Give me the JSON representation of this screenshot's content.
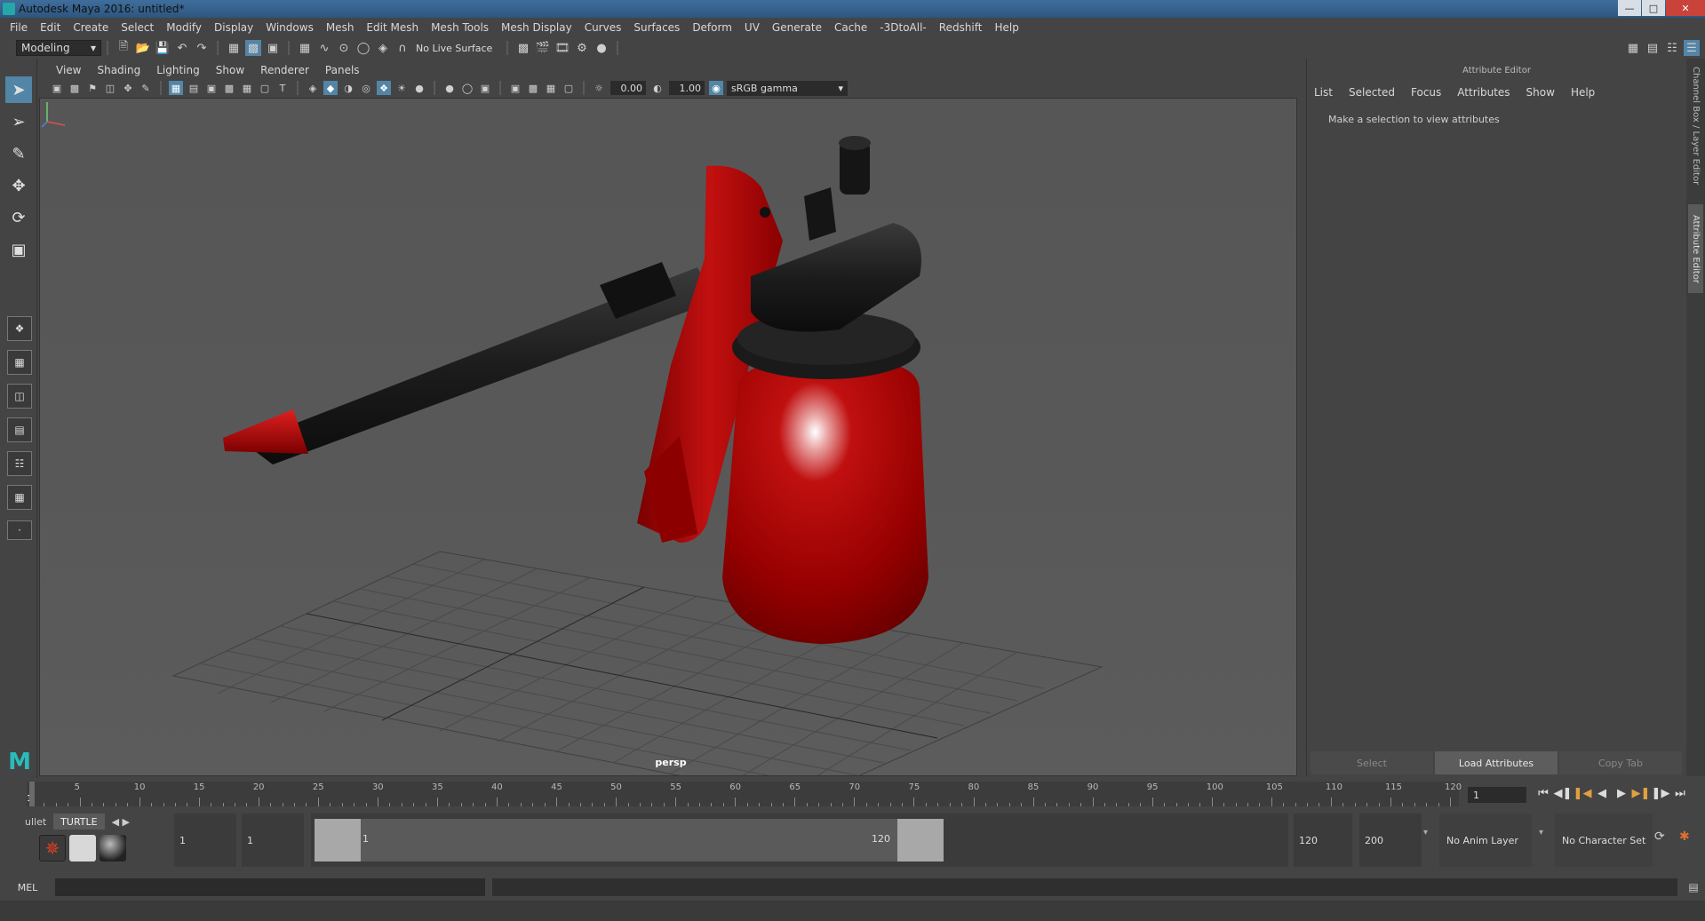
{
  "window": {
    "title": "Autodesk Maya 2016: untitled*"
  },
  "menubar": [
    "File",
    "Edit",
    "Create",
    "Select",
    "Modify",
    "Display",
    "Windows",
    "Mesh",
    "Edit Mesh",
    "Mesh Tools",
    "Mesh Display",
    "Curves",
    "Surfaces",
    "Deform",
    "UV",
    "Generate",
    "Cache",
    "-3DtoAll-",
    "Redshift",
    "Help"
  ],
  "statusline": {
    "mode": "Modeling",
    "live_surface": "No Live Surface"
  },
  "panel": {
    "menu": [
      "View",
      "Shading",
      "Lighting",
      "Show",
      "Renderer",
      "Panels"
    ],
    "exposure": "0.00",
    "gamma": "1.00",
    "colorspace": "sRGB gamma",
    "camera": "persp"
  },
  "attribute_editor": {
    "header": "Attribute Editor",
    "menu": [
      "List",
      "Selected",
      "Focus",
      "Attributes",
      "Show",
      "Help"
    ],
    "message": "Make a selection to view attributes",
    "buttons": {
      "select": "Select",
      "load": "Load Attributes",
      "copy": "Copy Tab"
    },
    "side_tabs": {
      "channel_box": "Channel Box / Layer Editor",
      "attribute_editor": "Attribute Editor"
    }
  },
  "timeslider": {
    "ticks": [
      "1",
      "5",
      "10",
      "15",
      "20",
      "25",
      "30",
      "35",
      "40",
      "45",
      "50",
      "55",
      "60",
      "65",
      "70",
      "75",
      "80",
      "85",
      "90",
      "95",
      "100",
      "105",
      "110",
      "115",
      "120"
    ],
    "current_frame": "1"
  },
  "shelf": {
    "tabs": [
      "ullet",
      "TURTLE"
    ]
  },
  "range": {
    "start": "1",
    "playback_start": "1",
    "slider_start": "1",
    "slider_end": "120",
    "playback_end": "120",
    "end": "200",
    "anim_layer": "No Anim Layer",
    "character_set": "No Character Set"
  },
  "cmdline": {
    "label": "MEL"
  }
}
